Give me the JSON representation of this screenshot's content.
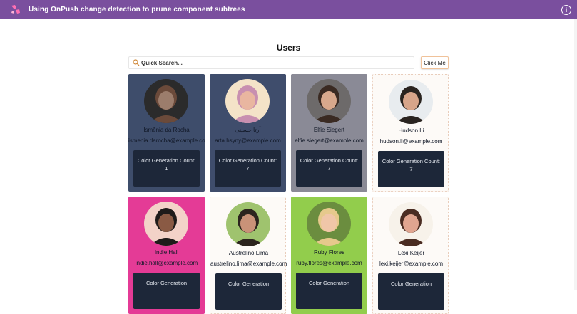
{
  "topbar": {
    "title": "Using OnPush change detection to prune component subtrees",
    "info_icon": "info-icon",
    "color": "#7a4f9e"
  },
  "page": {
    "title": "Users"
  },
  "search": {
    "placeholder": "Quick Search...",
    "value": ""
  },
  "toolbar": {
    "click_label": "Click Me"
  },
  "cards": [
    {
      "name": "Ismênia da Rocha",
      "email": "ismenia.darocha@example.com",
      "count_label": "Color Generation Count:",
      "count": "1",
      "bg": "#3e4d6b",
      "text": "#111827"
    },
    {
      "name": "آرتا حسینی",
      "email": "arta.hsyny@example.com",
      "count_label": "Color Generation Count:",
      "count": "7",
      "bg": "#3f4d6c",
      "text": "#111827"
    },
    {
      "name": "Elfie Siegert",
      "email": "elfie.siegert@example.com",
      "count_label": "Color Generation Count:",
      "count": "7",
      "bg": "#8a8a96",
      "text": "#111827"
    },
    {
      "name": "Hudson Li",
      "email": "hudson.li@example.com",
      "count_label": "Color Generation Count:",
      "count": "7",
      "bg": "#fdfaf7",
      "text": "#111827"
    },
    {
      "name": "Indie Hall",
      "email": "indie.hall@example.com",
      "count_label": "Color Generation",
      "count": "",
      "bg": "#e43b96",
      "text": "#111827"
    },
    {
      "name": "Austrelino Lima",
      "email": "austrelino.lima@example.com",
      "count_label": "Color Generation",
      "count": "",
      "bg": "#fdfaf7",
      "text": "#111827"
    },
    {
      "name": "Ruby Flores",
      "email": "ruby.flores@example.com",
      "count_label": "Color Generation",
      "count": "",
      "bg": "#92cd4c",
      "text": "#111827"
    },
    {
      "name": "Lexi Keijer",
      "email": "lexi.keijer@example.com",
      "count_label": "Color Generation",
      "count": "",
      "bg": "#fdfaf7",
      "text": "#111827"
    }
  ]
}
